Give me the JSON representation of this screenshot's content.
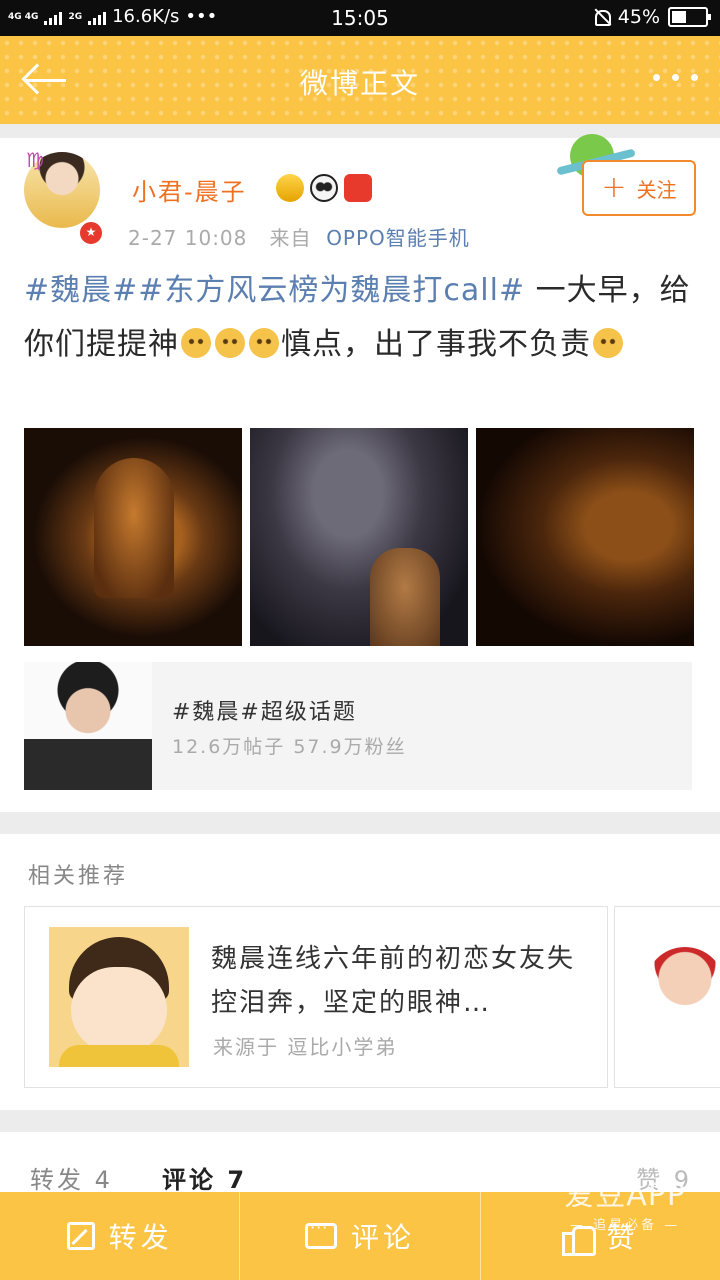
{
  "status_bar": {
    "network": "4G 4G",
    "network2": "2G",
    "speed": "16.6K/s",
    "dots": "•••",
    "time": "15:05",
    "battery": "45%",
    "battery_level": 0.45
  },
  "header": {
    "title": "微博正文",
    "background": "#fbc445"
  },
  "post": {
    "username": "小君-晨子",
    "avatar_deco": "♍",
    "timestamp": "2-27 10:08",
    "source_prefix": "来自",
    "source": "OPPO智能手机",
    "follow_label": "关注",
    "hashtags": "#魏晨##东方风云榜为魏晨打call#",
    "text_1": " 一大早，给你们提提神",
    "text_2": "慎点，出了事我不负责",
    "topic": {
      "title": "#魏晨#超级话题",
      "stats": "12.6万帖子  57.9万粉丝"
    }
  },
  "related": {
    "title": "相关推荐",
    "item": {
      "title": "魏晨连线六年前的初恋女友失控泪奔，坚定的眼神…",
      "source": "来源于  逗比小学弟"
    }
  },
  "stats": {
    "repost": "转发 4",
    "comment": "评论 7",
    "like": "赞 9"
  },
  "bottom_bar": {
    "repost": "转发",
    "comment": "评论",
    "like": "赞"
  },
  "watermark": {
    "main": "爱豆APP",
    "sub": "— 追星必备 —"
  }
}
